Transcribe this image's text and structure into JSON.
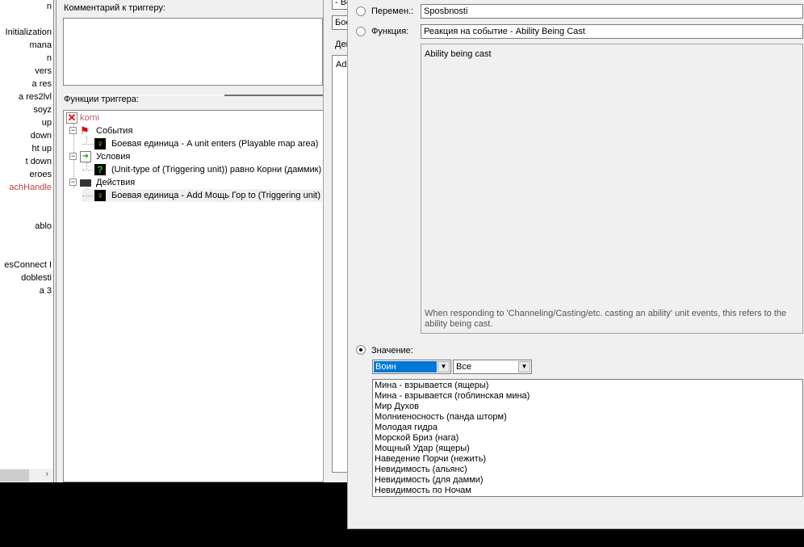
{
  "left_list": [
    {
      "label": "n",
      "red": false,
      "row": 0
    },
    {
      "label": "Initialization",
      "red": false,
      "row": 2
    },
    {
      "label": "mana",
      "red": false,
      "row": 3
    },
    {
      "label": "n",
      "red": false,
      "row": 4
    },
    {
      "label": "vers",
      "red": false,
      "row": 5
    },
    {
      "label": "a res",
      "red": false,
      "row": 6
    },
    {
      "label": "a res2lvl",
      "red": false,
      "row": 7
    },
    {
      "label": "soyz",
      "red": false,
      "row": 8
    },
    {
      "label": "up",
      "red": false,
      "row": 9
    },
    {
      "label": "down",
      "red": false,
      "row": 10
    },
    {
      "label": "ht up",
      "red": false,
      "row": 11
    },
    {
      "label": "t down",
      "red": false,
      "row": 12
    },
    {
      "label": "eroes",
      "red": false,
      "row": 13
    },
    {
      "label": "achHandle",
      "red": true,
      "row": 14
    },
    {
      "label": "ablo",
      "red": false,
      "row": 17
    },
    {
      "label": "esConnect I",
      "red": false,
      "row": 20
    },
    {
      "label": "doblesti",
      "red": false,
      "row": 21
    },
    {
      "label": "a 3",
      "red": false,
      "row": 22
    }
  ],
  "trigger": {
    "comment_label": "Комментарий к триггеру:",
    "functions_label": "Функции триггера:",
    "tree": {
      "name": "korni",
      "events_label": "События",
      "event": "Боевая единица - A unit enters (Playable map area)",
      "conditions_label": "Условия",
      "condition": "(Unit-type of (Triggering unit)) равно Корни (даммик)",
      "actions_label": "Действия",
      "action": "Боевая единица - Add Мощь Гор to (Triggering unit)"
    }
  },
  "background_dialog": {
    "field1": "- Во",
    "field2": "Бое",
    "label": "Дей",
    "box_text": "Add"
  },
  "dialog": {
    "variable_label": "Перемен.:",
    "variable_value": "Sposbnosti",
    "function_label": "Функция:",
    "function_value": "Реакция на событие - Ability Being Cast",
    "description_title": "Ability being cast",
    "description_text": "When responding to 'Channeling/Casting/etc. casting an ability' unit events, this refers to the ability being cast.",
    "value_label": "Значение:",
    "selected_radio": "value",
    "combo1": "Воин",
    "combo2": "Все",
    "abilities": [
      "Мина - взрывается  (ящеры)",
      "Мина - взрывается (гоблинская мина)",
      "Мир Духов",
      "Молниеносность (панда шторм)",
      "Молодая гидра",
      "Морской Бриз (нага)",
      "Мощный Удар (ящеры)",
      "Наведение Порчи (нежить)",
      "Невидимость (альянс)",
      "Невидимость (для дамми)",
      "Невидимость по Ночам"
    ]
  }
}
